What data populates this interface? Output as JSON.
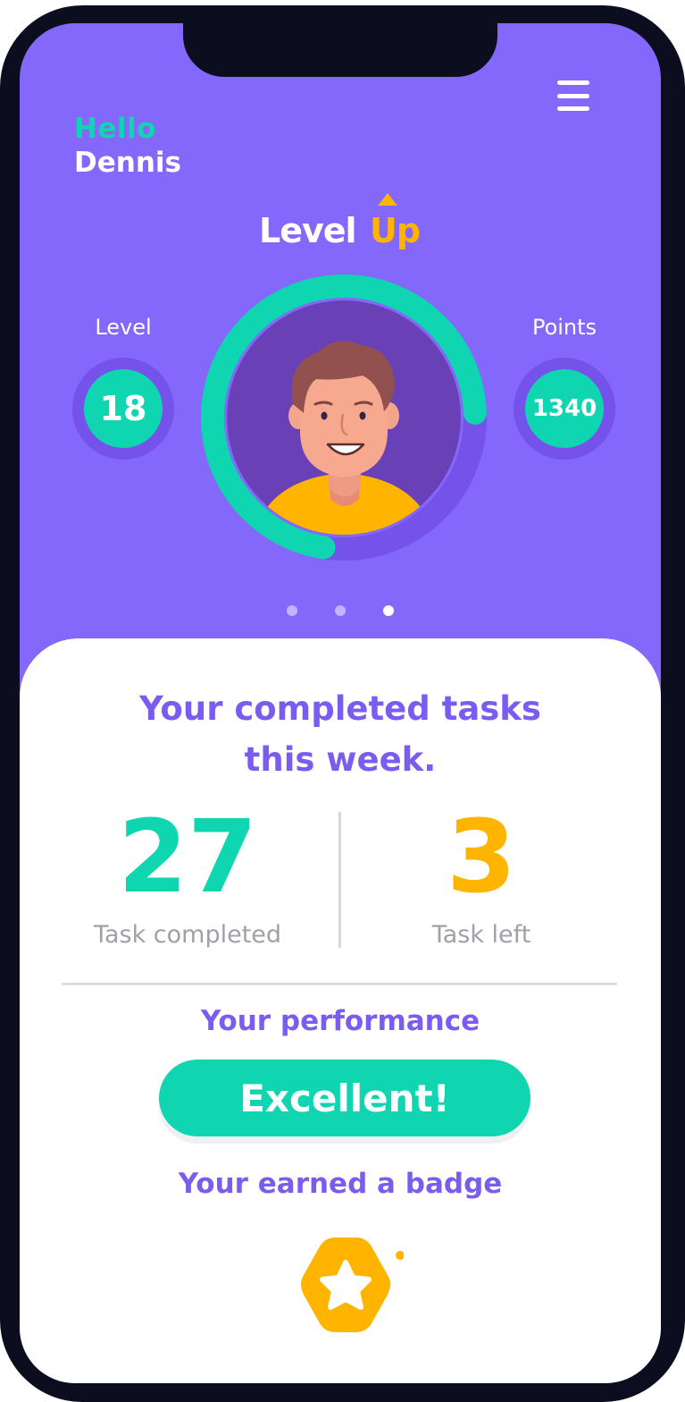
{
  "header": {
    "greeting": "Hello",
    "user_name": "Dennis",
    "menu_icon": "hamburger-menu-icon"
  },
  "logo": {
    "part1": "Level",
    "part2": "Up"
  },
  "stats": {
    "level_label": "Level",
    "level_value": "18",
    "points_label": "Points",
    "points_value": "1340"
  },
  "level_progress": 0.72,
  "carousel": {
    "count": 3,
    "active_index": 2
  },
  "summary": {
    "title_line1": "Your completed tasks",
    "title_line2": "this week.",
    "completed_value": "27",
    "completed_label": "Task completed",
    "left_value": "3",
    "left_label": "Task left",
    "performance_title": "Your performance",
    "performance_value": "Excellent!",
    "badge_title": "Your earned a badge",
    "badge_icon": "star-badge-icon"
  },
  "colors": {
    "primary": "#8467fb",
    "accent_teal": "#0fd6b1",
    "accent_yellow": "#ffb400",
    "heading_purple": "#7b5cf0",
    "muted_text": "#9ea1a7"
  }
}
